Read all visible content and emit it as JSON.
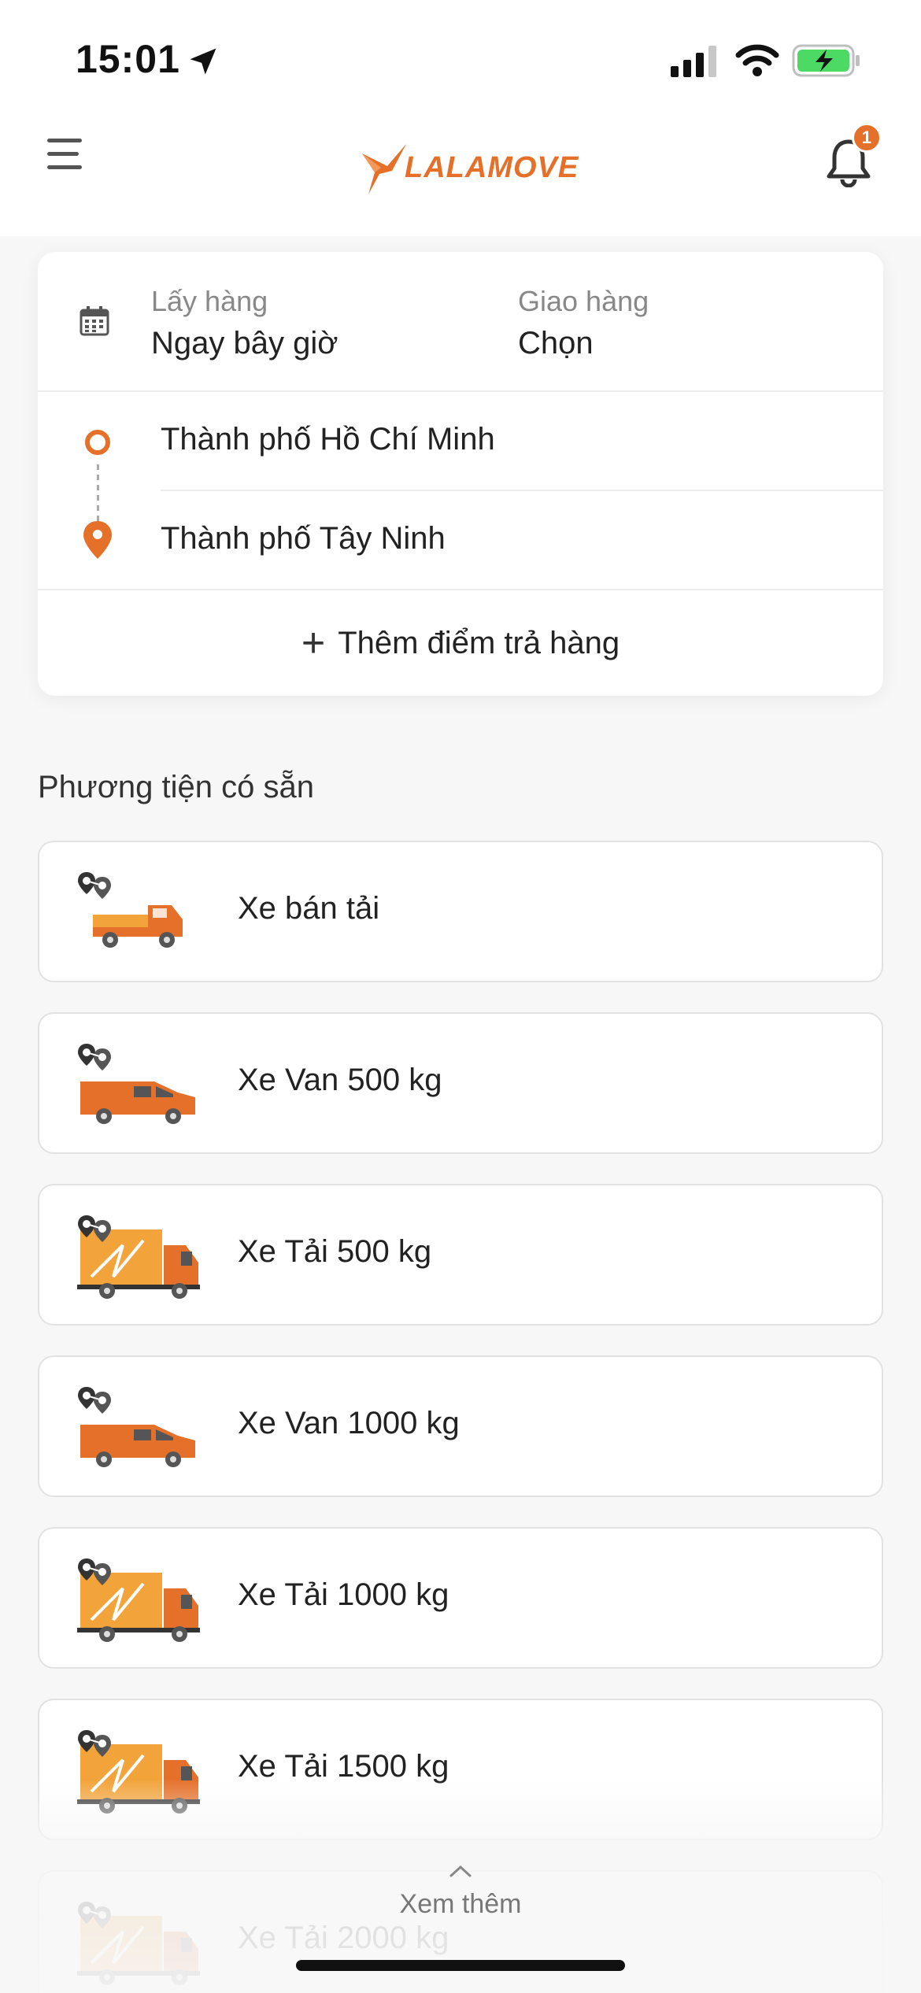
{
  "status_bar": {
    "time": "15:01"
  },
  "header": {
    "logo_text": "LALAMOVE",
    "notification_count": "1"
  },
  "schedule": {
    "pickup_label": "Lấy hàng",
    "pickup_value": "Ngay bây giờ",
    "delivery_label": "Giao hàng",
    "delivery_value": "Chọn"
  },
  "route": {
    "origin": "Thành phố Hồ Chí Minh",
    "destination": "Thành phố Tây Ninh",
    "add_stop_label": "Thêm điểm trả hàng"
  },
  "vehicles": {
    "section_title": "Phương tiện có sẵn",
    "items": [
      {
        "name": "Xe bán tải",
        "icon": "pickup-truck-icon"
      },
      {
        "name": "Xe Van 500 kg",
        "icon": "van-icon"
      },
      {
        "name": "Xe Tải 500 kg",
        "icon": "box-truck-icon"
      },
      {
        "name": "Xe Van 1000 kg",
        "icon": "van-icon"
      },
      {
        "name": "Xe Tải 1000 kg",
        "icon": "box-truck-icon"
      },
      {
        "name": "Xe Tải 1500 kg",
        "icon": "box-truck-icon"
      },
      {
        "name": "Xe Tải 2000 kg",
        "icon": "box-truck-icon"
      }
    ]
  },
  "see_more_label": "Xem thêm",
  "colors": {
    "accent": "#e5702a",
    "background": "#f7f7f7",
    "card": "#ffffff"
  }
}
